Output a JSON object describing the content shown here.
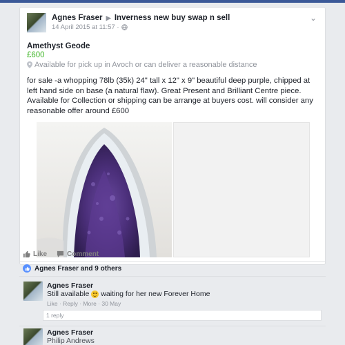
{
  "post": {
    "author": "Agnes Fraser",
    "group": "Inverness new buy swap n sell",
    "timestamp": "14 April 2015 at 11:57 ·",
    "listing_title": "Amethyst Geode",
    "price": "£600",
    "location": "Available for pick up in Avoch or can deliver a reasonable distance",
    "description": "for sale -a whopping 78lb (35k) 24\" tall x 12\" x 9\" beautiful deep purple, chipped at left hand side on base (a natural flaw). Great Present and Brilliant Centre piece. Available for Collection or shipping can be arrange at buyers cost. will consider any reasonable offer around £600"
  },
  "actions": {
    "like": "Like",
    "comment": "Comment"
  },
  "likes": {
    "summary": "Agnes Fraser and 9 others"
  },
  "comments": [
    {
      "name": "Agnes Fraser",
      "text_before": "Still available",
      "text_after": "waiting for her new Forever Home",
      "meta": "Like · Reply · More · 30 May",
      "reply_count": "1 reply"
    },
    {
      "name": "Agnes Fraser",
      "sub": "Philip Andrews"
    }
  ],
  "colors": {
    "brand": "#3b5998",
    "price": "#42b72a",
    "like_badge": "#5890ff",
    "geode_purple": "#4b2f7a"
  },
  "icons": {
    "location": "location-pin-icon",
    "globe": "globe-icon",
    "chevron": "chevron-down-icon",
    "like": "thumbs-up-icon",
    "comment": "comment-bubble-icon",
    "like_badge": "like-badge-icon",
    "smiley": "smiley-emoji-icon"
  }
}
